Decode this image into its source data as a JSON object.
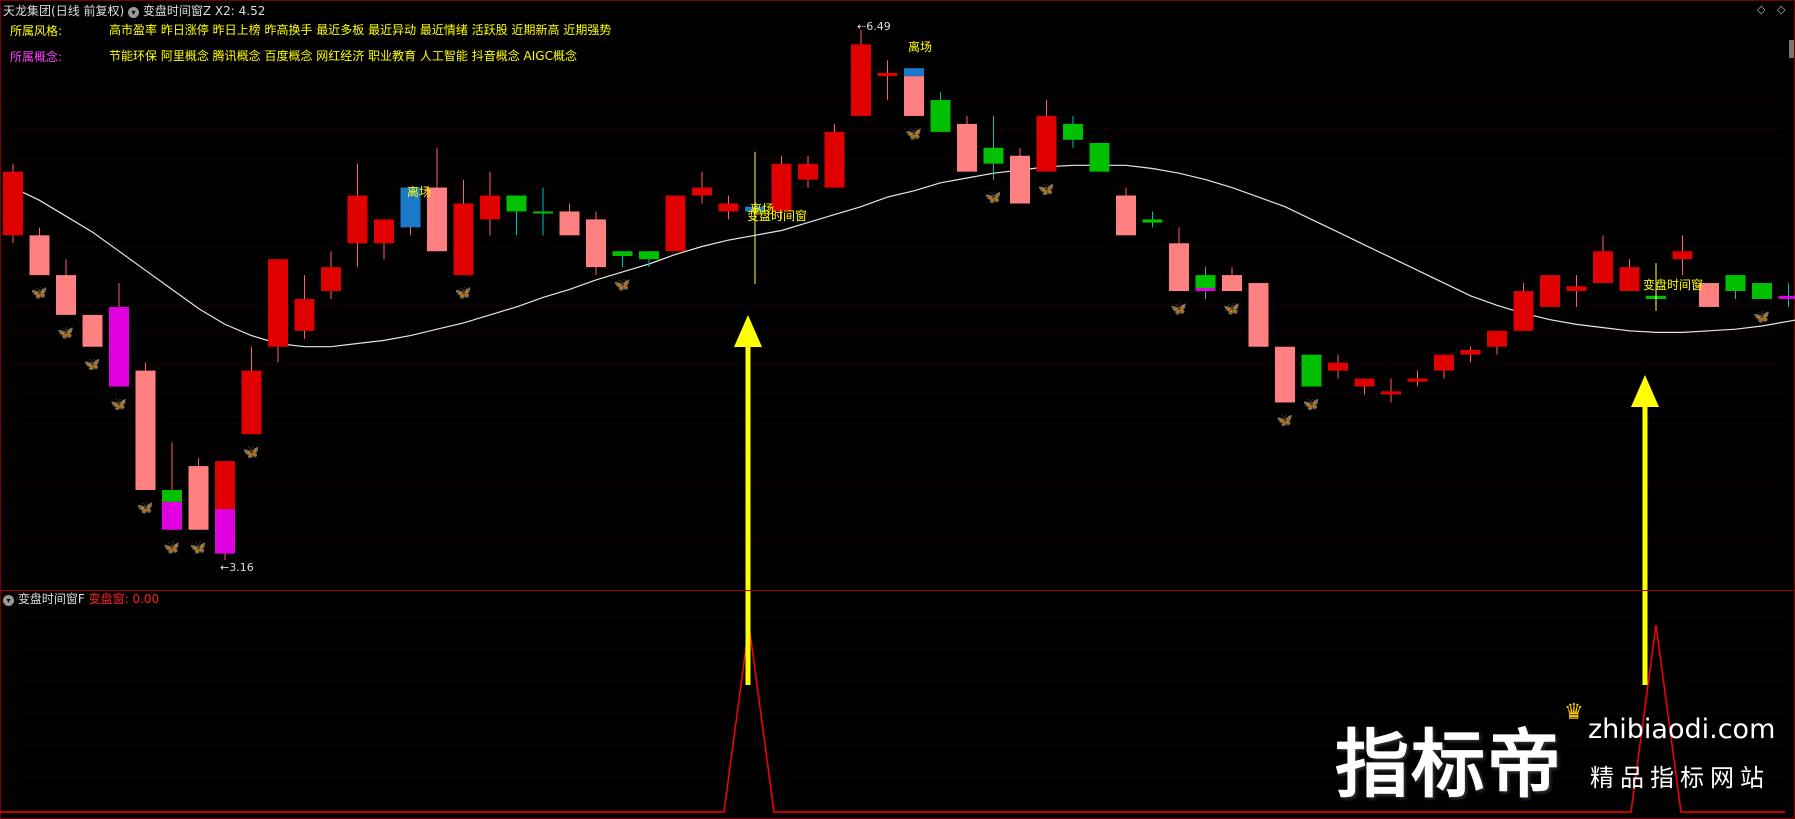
{
  "header": {
    "stock_name": "天龙集团",
    "mode": "(日线 前复权)",
    "indicator_name": "变盘时间窗Z",
    "x2_label": "X2:",
    "x2_value": "4.52"
  },
  "style_row": {
    "label": "所属风格:",
    "text": "高市盈率 昨日涨停 昨日上榜 昨高换手 最近多板 最近异动 最近情绪 活跃股 近期新高 近期强势"
  },
  "concept_row": {
    "label": "所属概念:",
    "text": "节能环保 阿里概念 腾讯概念 百度概念 网红经济 职业教育 人工智能 抖音概念 AIGC概念"
  },
  "annotations": {
    "high_price": "6.49",
    "low_price": "3.16",
    "leave1": "离场",
    "leave2": "离场",
    "leave3": "离场",
    "window1": "变盘时间窗",
    "window2": "变盘时间窗"
  },
  "sub_panel": {
    "indicator_name": "变盘时间窗F",
    "series_label": "变盘窗:",
    "series_value": "0.00"
  },
  "watermark": {
    "brand": "指标帝",
    "url": "zhibiaodi.com",
    "slogan": "精品指标网站"
  },
  "colors": {
    "up_light": "#ff8080",
    "up_dark": "#e00000",
    "down": "#00c000",
    "magenta": "#e000e0",
    "blue": "#1e78c8",
    "yellow_text": "#ffff00",
    "ma_line": "#e6e6e6",
    "arrow": "#ffff00",
    "sub_line": "#ff0000"
  },
  "icons": [
    "collapse-toggle-icon",
    "butterfly-signal-icon",
    "arrow-up-icon",
    "crown-icon"
  ],
  "chart_data": {
    "type": "candlestick",
    "y_high": 6.49,
    "y_low": 3.16,
    "candles": [
      {
        "o": 5.2,
        "c": 5.6,
        "h": 5.65,
        "l": 5.15,
        "k": "d"
      },
      {
        "o": 5.2,
        "c": 4.95,
        "h": 5.25,
        "l": 4.95,
        "k": "l"
      },
      {
        "o": 4.95,
        "c": 4.7,
        "h": 5.05,
        "l": 4.7,
        "k": "l"
      },
      {
        "o": 4.7,
        "c": 4.5,
        "h": 4.7,
        "l": 4.5,
        "k": "l"
      },
      {
        "o": 4.75,
        "c": 4.25,
        "h": 4.9,
        "l": 4.25,
        "k": "m"
      },
      {
        "o": 4.35,
        "c": 3.6,
        "h": 4.4,
        "l": 3.6,
        "k": "l"
      },
      {
        "o": 3.6,
        "c": 3.35,
        "h": 3.9,
        "l": 3.35,
        "k": "mg"
      },
      {
        "o": 3.35,
        "c": 3.75,
        "h": 3.8,
        "l": 3.35,
        "k": "l"
      },
      {
        "o": 3.48,
        "c": 3.2,
        "h": 3.75,
        "l": 3.16,
        "k": "md"
      },
      {
        "o": 3.95,
        "c": 4.35,
        "h": 4.5,
        "l": 3.95,
        "k": "d"
      },
      {
        "o": 4.5,
        "c": 5.05,
        "h": 5.05,
        "l": 4.4,
        "k": "d"
      },
      {
        "o": 4.6,
        "c": 4.8,
        "h": 4.95,
        "l": 4.55,
        "k": "d"
      },
      {
        "o": 4.85,
        "c": 5.0,
        "h": 5.1,
        "l": 4.8,
        "k": "d"
      },
      {
        "o": 5.15,
        "c": 5.45,
        "h": 5.65,
        "l": 5.0,
        "k": "d"
      },
      {
        "o": 5.15,
        "c": 5.3,
        "h": 5.3,
        "l": 5.05,
        "k": "d"
      },
      {
        "o": 5.25,
        "c": 5.5,
        "h": 5.5,
        "l": 5.2,
        "k": "b"
      },
      {
        "o": 5.5,
        "c": 5.1,
        "h": 5.75,
        "l": 5.1,
        "k": "l"
      },
      {
        "o": 4.95,
        "c": 5.4,
        "h": 5.55,
        "l": 4.95,
        "k": "d"
      },
      {
        "o": 5.3,
        "c": 5.45,
        "h": 5.6,
        "l": 5.2,
        "k": "d"
      },
      {
        "o": 5.45,
        "c": 5.35,
        "h": 5.45,
        "l": 5.2,
        "k": "g"
      },
      {
        "o": 5.35,
        "c": 5.34,
        "h": 5.5,
        "l": 5.2,
        "k": "g"
      },
      {
        "o": 5.35,
        "c": 5.2,
        "h": 5.4,
        "l": 5.2,
        "k": "l"
      },
      {
        "o": 5.3,
        "c": 5.0,
        "h": 5.35,
        "l": 4.95,
        "k": "l"
      },
      {
        "o": 5.1,
        "c": 5.07,
        "h": 5.1,
        "l": 5.0,
        "k": "g"
      },
      {
        "o": 5.1,
        "c": 5.05,
        "h": 5.1,
        "l": 5.0,
        "k": "g"
      },
      {
        "o": 5.1,
        "c": 5.45,
        "h": 5.45,
        "l": 5.1,
        "k": "d"
      },
      {
        "o": 5.45,
        "c": 5.5,
        "h": 5.6,
        "l": 5.4,
        "k": "d"
      },
      {
        "o": 5.35,
        "c": 5.4,
        "h": 5.45,
        "l": 5.3,
        "k": "d"
      },
      {
        "o": 5.35,
        "c": 5.38,
        "h": 5.65,
        "l": 4.92,
        "k": "b"
      },
      {
        "o": 5.35,
        "c": 5.65,
        "h": 5.7,
        "l": 5.3,
        "k": "d"
      },
      {
        "o": 5.55,
        "c": 5.65,
        "h": 5.7,
        "l": 5.5,
        "k": "d"
      },
      {
        "o": 5.5,
        "c": 5.85,
        "h": 5.9,
        "l": 5.5,
        "k": "d"
      },
      {
        "o": 5.95,
        "c": 6.4,
        "h": 6.49,
        "l": 5.95,
        "k": "d"
      },
      {
        "o": 6.2,
        "c": 6.22,
        "h": 6.3,
        "l": 6.05,
        "k": "d"
      },
      {
        "o": 6.25,
        "c": 5.95,
        "h": 6.25,
        "l": 5.95,
        "k": "lb"
      },
      {
        "o": 6.05,
        "c": 5.85,
        "h": 6.1,
        "l": 5.85,
        "k": "g"
      },
      {
        "o": 5.6,
        "c": 5.9,
        "h": 5.95,
        "l": 5.6,
        "k": "l"
      },
      {
        "o": 5.75,
        "c": 5.65,
        "h": 5.95,
        "l": 5.55,
        "k": "g"
      },
      {
        "o": 5.4,
        "c": 5.7,
        "h": 5.75,
        "l": 5.4,
        "k": "l"
      },
      {
        "o": 5.6,
        "c": 5.95,
        "h": 6.05,
        "l": 5.6,
        "k": "d"
      },
      {
        "o": 5.9,
        "c": 5.8,
        "h": 5.95,
        "l": 5.75,
        "k": "g"
      },
      {
        "o": 5.78,
        "c": 5.6,
        "h": 5.78,
        "l": 5.6,
        "k": "g"
      },
      {
        "o": 5.2,
        "c": 5.45,
        "h": 5.5,
        "l": 5.2,
        "k": "l"
      },
      {
        "o": 5.3,
        "c": 5.28,
        "h": 5.35,
        "l": 5.25,
        "k": "g"
      },
      {
        "o": 4.85,
        "c": 5.15,
        "h": 5.25,
        "l": 4.85,
        "k": "l"
      },
      {
        "o": 4.95,
        "c": 4.85,
        "h": 5.0,
        "l": 4.8,
        "k": "gm"
      },
      {
        "o": 4.85,
        "c": 4.95,
        "h": 5.0,
        "l": 4.85,
        "k": "l"
      },
      {
        "o": 4.5,
        "c": 4.9,
        "h": 4.9,
        "l": 4.5,
        "k": "l"
      },
      {
        "o": 4.15,
        "c": 4.5,
        "h": 4.5,
        "l": 4.15,
        "k": "l"
      },
      {
        "o": 4.45,
        "c": 4.25,
        "h": 4.45,
        "l": 4.25,
        "k": "g"
      },
      {
        "o": 4.35,
        "c": 4.4,
        "h": 4.45,
        "l": 4.3,
        "k": "d"
      },
      {
        "o": 4.3,
        "c": 4.25,
        "h": 4.3,
        "l": 4.2,
        "k": "d"
      },
      {
        "o": 4.2,
        "c": 4.22,
        "h": 4.3,
        "l": 4.15,
        "k": "d"
      },
      {
        "o": 4.28,
        "c": 4.3,
        "h": 4.35,
        "l": 4.25,
        "k": "d"
      },
      {
        "o": 4.35,
        "c": 4.45,
        "h": 4.45,
        "l": 4.3,
        "k": "d"
      },
      {
        "o": 4.45,
        "c": 4.48,
        "h": 4.5,
        "l": 4.4,
        "k": "d"
      },
      {
        "o": 4.5,
        "c": 4.6,
        "h": 4.6,
        "l": 4.45,
        "k": "d"
      },
      {
        "o": 4.6,
        "c": 4.85,
        "h": 4.9,
        "l": 4.6,
        "k": "d"
      },
      {
        "o": 4.75,
        "c": 4.95,
        "h": 4.95,
        "l": 4.75,
        "k": "d"
      },
      {
        "o": 4.85,
        "c": 4.88,
        "h": 4.95,
        "l": 4.75,
        "k": "d"
      },
      {
        "o": 4.9,
        "c": 5.1,
        "h": 5.2,
        "l": 4.9,
        "k": "d"
      },
      {
        "o": 4.85,
        "c": 5.0,
        "h": 5.05,
        "l": 4.85,
        "k": "d"
      },
      {
        "o": 4.82,
        "c": 4.8,
        "h": 4.95,
        "l": 4.75,
        "k": "g"
      },
      {
        "o": 5.05,
        "c": 5.1,
        "h": 5.2,
        "l": 4.95,
        "k": "d"
      },
      {
        "o": 4.75,
        "c": 4.9,
        "h": 4.9,
        "l": 4.75,
        "k": "l"
      },
      {
        "o": 4.95,
        "c": 4.85,
        "h": 4.95,
        "l": 4.8,
        "k": "g"
      },
      {
        "o": 4.9,
        "c": 4.8,
        "h": 4.9,
        "l": 4.8,
        "k": "g"
      },
      {
        "o": 4.82,
        "c": 4.8,
        "h": 4.9,
        "l": 4.75,
        "k": "gm"
      }
    ],
    "ma_line": [
      5.5,
      5.42,
      5.32,
      5.22,
      5.1,
      4.98,
      4.86,
      4.74,
      4.64,
      4.57,
      4.52,
      4.5,
      4.5,
      4.52,
      4.54,
      4.57,
      4.61,
      4.65,
      4.7,
      4.75,
      4.81,
      4.86,
      4.92,
      4.97,
      5.02,
      5.08,
      5.13,
      5.17,
      5.2,
      5.23,
      5.28,
      5.33,
      5.38,
      5.44,
      5.48,
      5.53,
      5.56,
      5.59,
      5.61,
      5.63,
      5.64,
      5.64,
      5.64,
      5.62,
      5.59,
      5.55,
      5.5,
      5.44,
      5.38,
      5.3,
      5.22,
      5.14,
      5.06,
      4.98,
      4.9,
      4.82,
      4.76,
      4.71,
      4.67,
      4.64,
      4.62,
      4.6,
      4.59,
      4.59,
      4.6,
      4.61,
      4.63,
      4.66,
      4.69
    ],
    "signals_butterfly": [
      1,
      2,
      3,
      4,
      5,
      6,
      7,
      9,
      17,
      23,
      34,
      37,
      39,
      44,
      46,
      48,
      49,
      66
    ],
    "window_signal_bars": [
      28,
      62
    ]
  }
}
